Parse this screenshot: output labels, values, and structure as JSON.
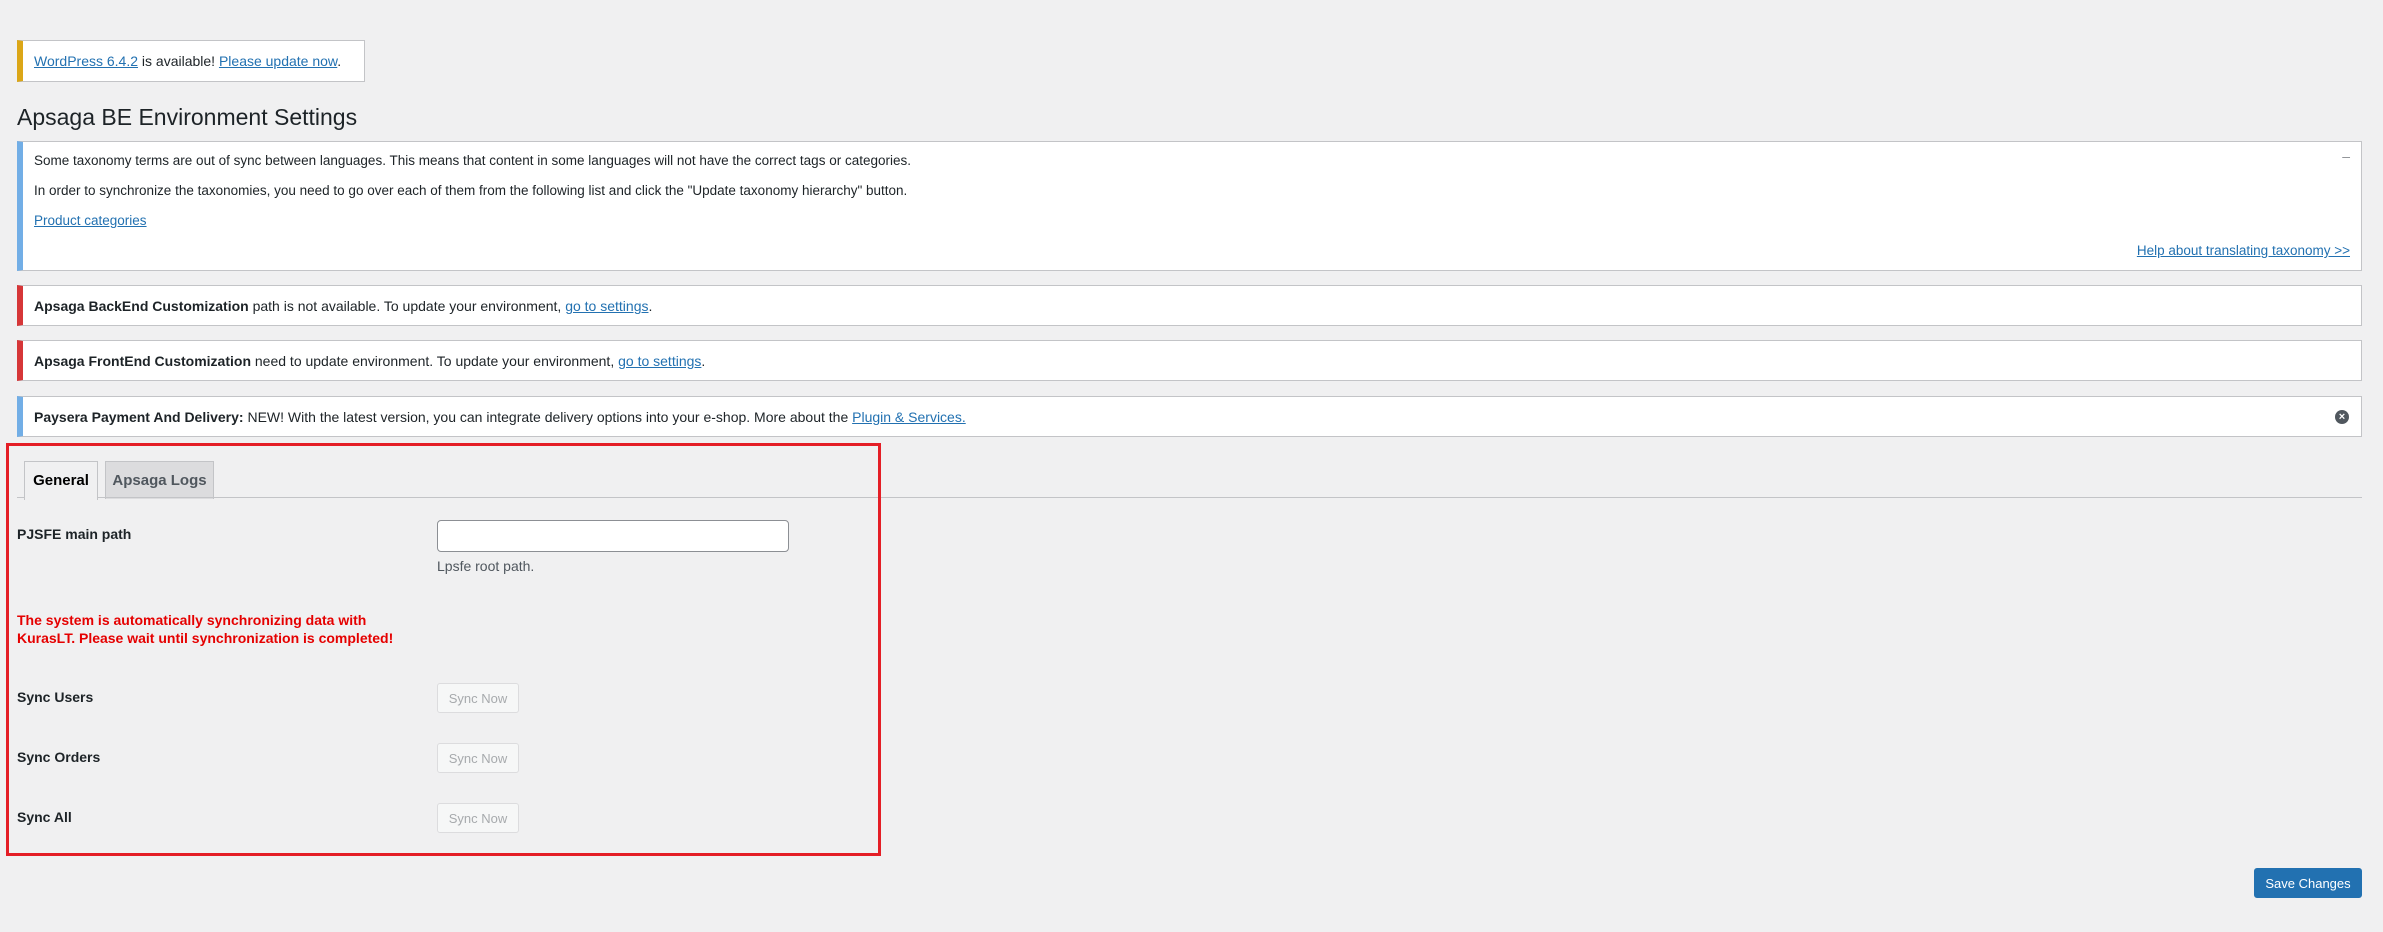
{
  "update_nag": {
    "wp_link": "WordPress 6.4.2",
    "middle": " is available! ",
    "update_link": "Please update now",
    "end": "."
  },
  "page_title": "Apsaga BE Environment Settings",
  "taxonomy_notice": {
    "line1": "Some taxonomy terms are out of sync between languages. This means that content in some languages will not have the correct tags or categories.",
    "line2": "In order to synchronize the taxonomies, you need to go over each of them from the following list and click the \"Update taxonomy hierarchy\" button.",
    "link": "Product categories",
    "help_link": "Help about translating taxonomy >>",
    "collapse_symbol": "–"
  },
  "backend_notice": {
    "bold": "Apsaga BackEnd Customization",
    "text": " path is not available. To update your environment, ",
    "link": "go to settings",
    "end": "."
  },
  "frontend_notice": {
    "bold": "Apsaga FrontEnd Customization",
    "text": " need to update environment. To update your environment, ",
    "link": "go to settings",
    "end": "."
  },
  "paysera_notice": {
    "bold": "Paysera Payment And Delivery:",
    "text": " NEW! With the latest version, you can integrate delivery options into your e-shop. More about the ",
    "link": "Plugin & Services.",
    "dismiss_symbol": "×"
  },
  "tabs": [
    {
      "label": "General",
      "active": true
    },
    {
      "label": "Apsaga Logs",
      "active": false
    }
  ],
  "settings": {
    "main_path_label": "PJSFE main path",
    "main_path_value": "",
    "main_path_desc": "Lpsfe root path.",
    "sync_warning": "The system is automatically synchronizing data with KurasLT. Please wait until synchronization is completed!",
    "sync_rows": [
      {
        "label": "Sync Users",
        "button": "Sync Now"
      },
      {
        "label": "Sync Orders",
        "button": "Sync Now"
      },
      {
        "label": "Sync All",
        "button": "Sync Now"
      }
    ]
  },
  "save_button": "Save Changes",
  "colors": {
    "accent": "#2271b1",
    "error": "#d63638",
    "warning": "#dba617",
    "info": "#72aee6",
    "highlight": "#e41e26",
    "sync_warning": "#e50000"
  },
  "icons": {
    "dismiss": "dismiss-icon",
    "collapse": "collapse-icon"
  }
}
